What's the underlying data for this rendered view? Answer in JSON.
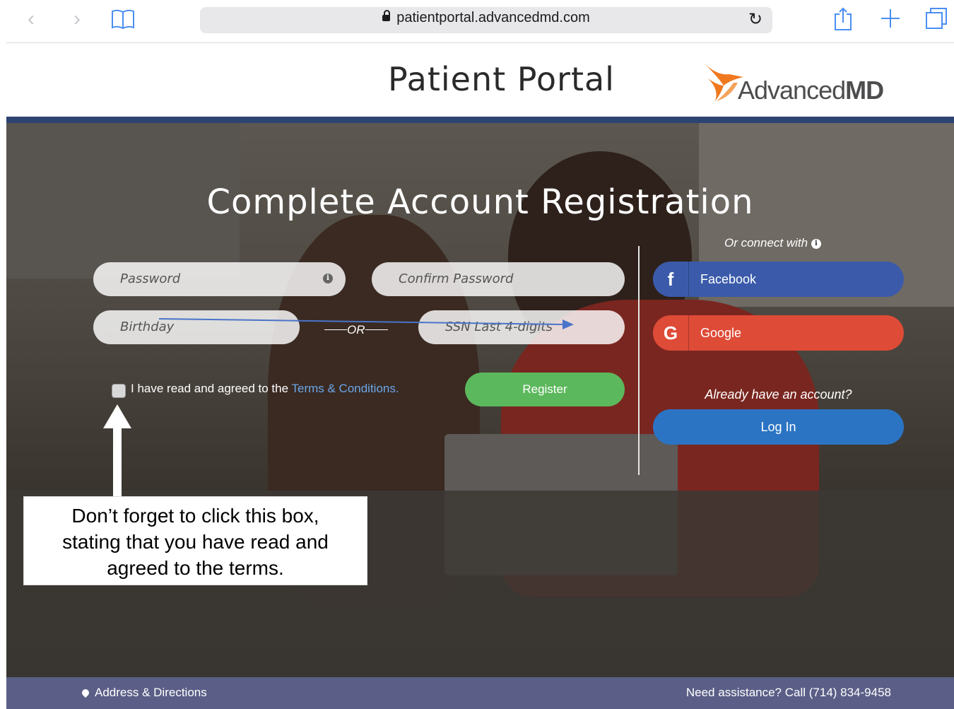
{
  "browser": {
    "url": "patientportal.advancedmd.com"
  },
  "header": {
    "title": "Patient Portal",
    "logo_text_regular": "Advanced",
    "logo_text_bold": "MD"
  },
  "form": {
    "heading": "Complete Account Registration",
    "password_placeholder": "Password",
    "confirm_password_placeholder": "Confirm Password",
    "birthday_placeholder": "Birthday",
    "or_label": "OR",
    "ssn_placeholder": "SSN Last 4-digits",
    "agree_prefix": "I have read and agreed to the ",
    "terms_link": "Terms & Conditions.",
    "register_label": "Register"
  },
  "social": {
    "connect_label": "Or connect with",
    "facebook_label": "Facebook",
    "google_label": "Google",
    "already_label": "Already have an account?",
    "login_label": "Log In"
  },
  "annotation": {
    "line1": "Don’t forget to click this box,",
    "line2": "stating that you have read and",
    "line3": "agreed to the terms."
  },
  "footer": {
    "address_label": "Address & Directions",
    "assistance_label": "Need assistance? Call (714) 834-9458"
  },
  "colors": {
    "header_stripe": "#2d4372",
    "register_green": "#5cb85c",
    "facebook_blue": "#3b5baa",
    "google_red": "#de4b37",
    "login_blue": "#2b74c4",
    "footer_bg": "#5b5f87",
    "logo_orange": "#f0781e"
  }
}
